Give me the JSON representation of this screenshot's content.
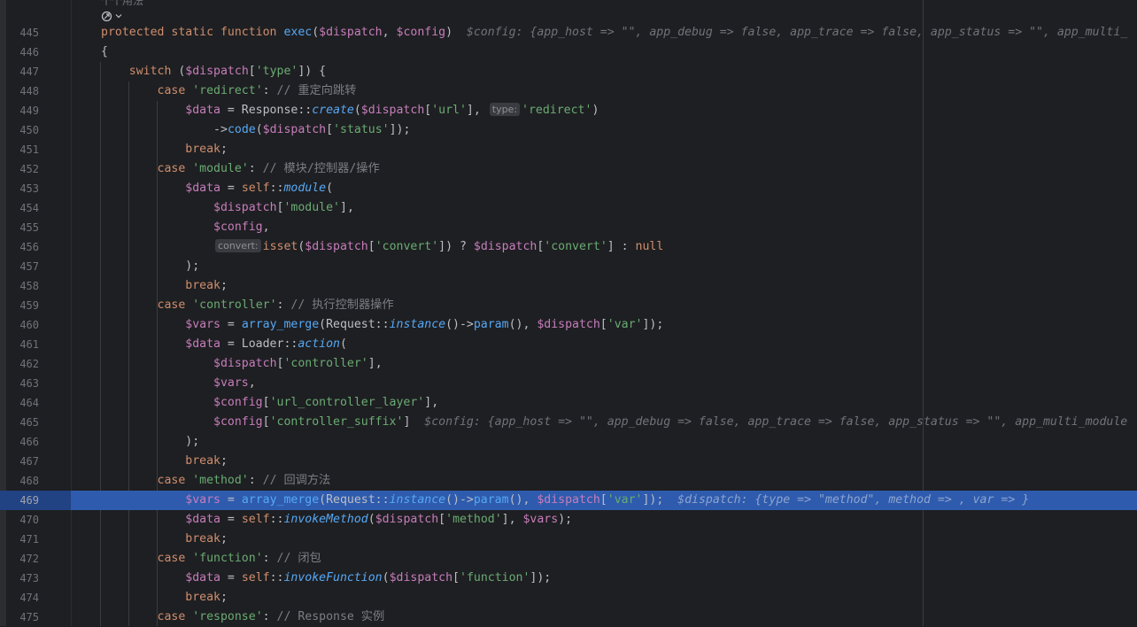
{
  "editor": {
    "top_fragment": "个个用法",
    "lines": [
      {
        "n": "445",
        "indent": 0,
        "parts": [
          [
            "k",
            "protected static function "
          ],
          [
            "f",
            "exec"
          ],
          [
            "p",
            "("
          ],
          [
            "v",
            "$dispatch"
          ],
          [
            "p",
            ", "
          ],
          [
            "v",
            "$config"
          ],
          [
            "p",
            ")"
          ],
          [
            "hint",
            "  $config: {app_host => \"\", app_debug => false, app_trace => false, app_status => \"\", app_multi_"
          ]
        ]
      },
      {
        "n": "446",
        "indent": 0,
        "parts": [
          [
            "p",
            "{"
          ]
        ]
      },
      {
        "n": "447",
        "indent": 1,
        "parts": [
          [
            "k",
            "switch "
          ],
          [
            "p",
            "("
          ],
          [
            "v",
            "$dispatch"
          ],
          [
            "p",
            "["
          ],
          [
            "s",
            "'type'"
          ],
          [
            "p",
            "]) {"
          ]
        ]
      },
      {
        "n": "448",
        "indent": 2,
        "parts": [
          [
            "k",
            "case "
          ],
          [
            "s",
            "'redirect'"
          ],
          [
            "p",
            ": "
          ],
          [
            "c",
            "// 重定向跳转"
          ]
        ]
      },
      {
        "n": "449",
        "indent": 3,
        "parts": [
          [
            "v",
            "$data"
          ],
          [
            "p",
            " = Response::"
          ],
          [
            "sf",
            "create"
          ],
          [
            "p",
            "("
          ],
          [
            "v",
            "$dispatch"
          ],
          [
            "p",
            "["
          ],
          [
            "s",
            "'url'"
          ],
          [
            "p",
            "], "
          ],
          [
            "ph",
            "type:"
          ],
          [
            "s",
            "'redirect'"
          ],
          [
            "p",
            ")"
          ]
        ]
      },
      {
        "n": "450",
        "indent": 4,
        "parts": [
          [
            "p",
            "->"
          ],
          [
            "f",
            "code"
          ],
          [
            "p",
            "("
          ],
          [
            "v",
            "$dispatch"
          ],
          [
            "p",
            "["
          ],
          [
            "s",
            "'status'"
          ],
          [
            "p",
            "]);"
          ]
        ]
      },
      {
        "n": "451",
        "indent": 3,
        "parts": [
          [
            "k",
            "break"
          ],
          [
            "p",
            ";"
          ]
        ]
      },
      {
        "n": "452",
        "indent": 2,
        "parts": [
          [
            "k",
            "case "
          ],
          [
            "s",
            "'module'"
          ],
          [
            "p",
            ": "
          ],
          [
            "c",
            "// 模块/控制器/操作"
          ]
        ]
      },
      {
        "n": "453",
        "indent": 3,
        "parts": [
          [
            "v",
            "$data"
          ],
          [
            "p",
            " = "
          ],
          [
            "k",
            "self"
          ],
          [
            "p",
            "::"
          ],
          [
            "sf",
            "module"
          ],
          [
            "p",
            "("
          ]
        ]
      },
      {
        "n": "454",
        "indent": 4,
        "parts": [
          [
            "v",
            "$dispatch"
          ],
          [
            "p",
            "["
          ],
          [
            "s",
            "'module'"
          ],
          [
            "p",
            "],"
          ]
        ]
      },
      {
        "n": "455",
        "indent": 4,
        "parts": [
          [
            "v",
            "$config"
          ],
          [
            "p",
            ","
          ]
        ]
      },
      {
        "n": "456",
        "indent": 4,
        "parts": [
          [
            "ph",
            "convert:"
          ],
          [
            "k",
            "isset"
          ],
          [
            "p",
            "("
          ],
          [
            "v",
            "$dispatch"
          ],
          [
            "p",
            "["
          ],
          [
            "s",
            "'convert'"
          ],
          [
            "p",
            "]) ? "
          ],
          [
            "v",
            "$dispatch"
          ],
          [
            "p",
            "["
          ],
          [
            "s",
            "'convert'"
          ],
          [
            "p",
            "] : "
          ],
          [
            "k",
            "null"
          ]
        ]
      },
      {
        "n": "457",
        "indent": 3,
        "parts": [
          [
            "p",
            ");"
          ]
        ]
      },
      {
        "n": "458",
        "indent": 3,
        "parts": [
          [
            "k",
            "break"
          ],
          [
            "p",
            ";"
          ]
        ]
      },
      {
        "n": "459",
        "indent": 2,
        "parts": [
          [
            "k",
            "case "
          ],
          [
            "s",
            "'controller'"
          ],
          [
            "p",
            ": "
          ],
          [
            "c",
            "// 执行控制器操作"
          ]
        ]
      },
      {
        "n": "460",
        "indent": 3,
        "parts": [
          [
            "v",
            "$vars"
          ],
          [
            "p",
            " = "
          ],
          [
            "f",
            "array_merge"
          ],
          [
            "p",
            "(Request::"
          ],
          [
            "sf",
            "instance"
          ],
          [
            "p",
            "()->"
          ],
          [
            "f",
            "param"
          ],
          [
            "p",
            "(), "
          ],
          [
            "v",
            "$dispatch"
          ],
          [
            "p",
            "["
          ],
          [
            "s",
            "'var'"
          ],
          [
            "p",
            "]);"
          ]
        ]
      },
      {
        "n": "461",
        "indent": 3,
        "parts": [
          [
            "v",
            "$data"
          ],
          [
            "p",
            " = Loader::"
          ],
          [
            "sf",
            "action"
          ],
          [
            "p",
            "("
          ]
        ]
      },
      {
        "n": "462",
        "indent": 4,
        "parts": [
          [
            "v",
            "$dispatch"
          ],
          [
            "p",
            "["
          ],
          [
            "s",
            "'controller'"
          ],
          [
            "p",
            "],"
          ]
        ]
      },
      {
        "n": "463",
        "indent": 4,
        "parts": [
          [
            "v",
            "$vars"
          ],
          [
            "p",
            ","
          ]
        ]
      },
      {
        "n": "464",
        "indent": 4,
        "parts": [
          [
            "v",
            "$config"
          ],
          [
            "p",
            "["
          ],
          [
            "s",
            "'url_controller_layer'"
          ],
          [
            "p",
            "],"
          ]
        ]
      },
      {
        "n": "465",
        "indent": 4,
        "parts": [
          [
            "v",
            "$config"
          ],
          [
            "p",
            "["
          ],
          [
            "s",
            "'controller_suffix'"
          ],
          [
            "p",
            "]"
          ],
          [
            "hint",
            "  $config: {app_host => \"\", app_debug => false, app_trace => false, app_status => \"\", app_multi_module"
          ]
        ]
      },
      {
        "n": "466",
        "indent": 3,
        "parts": [
          [
            "p",
            ");"
          ]
        ]
      },
      {
        "n": "467",
        "indent": 3,
        "parts": [
          [
            "k",
            "break"
          ],
          [
            "p",
            ";"
          ]
        ]
      },
      {
        "n": "468",
        "indent": 2,
        "parts": [
          [
            "k",
            "case "
          ],
          [
            "s",
            "'method'"
          ],
          [
            "p",
            ": "
          ],
          [
            "c",
            "// 回调方法"
          ]
        ]
      },
      {
        "n": "469",
        "indent": 3,
        "hl": true,
        "parts": [
          [
            "v",
            "$vars"
          ],
          [
            "p",
            " = "
          ],
          [
            "f",
            "array_merge"
          ],
          [
            "p",
            "(Request::"
          ],
          [
            "sf",
            "instance"
          ],
          [
            "p",
            "()->"
          ],
          [
            "f",
            "param"
          ],
          [
            "p",
            "(), "
          ],
          [
            "v",
            "$dispatch"
          ],
          [
            "p",
            "["
          ],
          [
            "s",
            "'var'"
          ],
          [
            "p",
            "]);"
          ],
          [
            "hint",
            "  $dispatch: {type => \"method\", method => , var => }"
          ]
        ]
      },
      {
        "n": "470",
        "indent": 3,
        "parts": [
          [
            "v",
            "$data"
          ],
          [
            "p",
            " = "
          ],
          [
            "k",
            "self"
          ],
          [
            "p",
            "::"
          ],
          [
            "sf",
            "invokeMethod"
          ],
          [
            "p",
            "("
          ],
          [
            "v",
            "$dispatch"
          ],
          [
            "p",
            "["
          ],
          [
            "s",
            "'method'"
          ],
          [
            "p",
            "], "
          ],
          [
            "v",
            "$vars"
          ],
          [
            "p",
            ");"
          ]
        ]
      },
      {
        "n": "471",
        "indent": 3,
        "parts": [
          [
            "k",
            "break"
          ],
          [
            "p",
            ";"
          ]
        ]
      },
      {
        "n": "472",
        "indent": 2,
        "parts": [
          [
            "k",
            "case "
          ],
          [
            "s",
            "'function'"
          ],
          [
            "p",
            ": "
          ],
          [
            "c",
            "// 闭包"
          ]
        ]
      },
      {
        "n": "473",
        "indent": 3,
        "parts": [
          [
            "v",
            "$data"
          ],
          [
            "p",
            " = "
          ],
          [
            "k",
            "self"
          ],
          [
            "p",
            "::"
          ],
          [
            "sf",
            "invokeFunction"
          ],
          [
            "p",
            "("
          ],
          [
            "v",
            "$dispatch"
          ],
          [
            "p",
            "["
          ],
          [
            "s",
            "'function'"
          ],
          [
            "p",
            "]);"
          ]
        ]
      },
      {
        "n": "474",
        "indent": 3,
        "parts": [
          [
            "k",
            "break"
          ],
          [
            "p",
            ";"
          ]
        ]
      },
      {
        "n": "475",
        "indent": 2,
        "parts": [
          [
            "k",
            "case "
          ],
          [
            "s",
            "'response'"
          ],
          [
            "p",
            ": "
          ],
          [
            "c",
            "// Response 实例"
          ]
        ]
      }
    ]
  },
  "theme": {
    "background": "#1e1f22",
    "highlight": "#214283",
    "keyword": "#cf8e6d",
    "variable": "#c77dbb",
    "string": "#6aab73",
    "function": "#56a8f5",
    "comment": "#7a7e85"
  }
}
